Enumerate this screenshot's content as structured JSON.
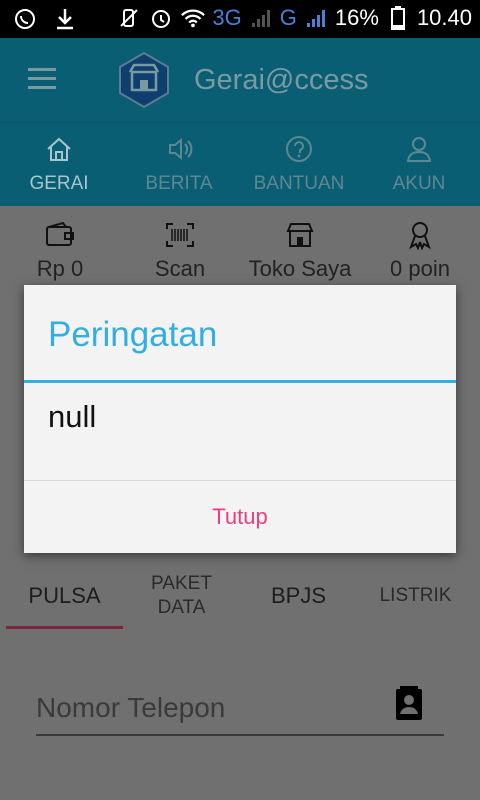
{
  "status_bar": {
    "network_3g": "3G",
    "network_g": "G",
    "battery": "16%",
    "time": "10.40"
  },
  "app_bar": {
    "title": "Gerai@ccess"
  },
  "top_tabs": [
    {
      "label": "GERAI",
      "icon": "home-icon",
      "active": true
    },
    {
      "label": "BERITA",
      "icon": "speaker-icon",
      "active": false
    },
    {
      "label": "BANTUAN",
      "icon": "help-icon",
      "active": false
    },
    {
      "label": "AKUN",
      "icon": "user-icon",
      "active": false
    }
  ],
  "wallet_row": [
    {
      "label": "Rp 0",
      "icon": "wallet-icon"
    },
    {
      "label": "Scan",
      "icon": "barcode-icon"
    },
    {
      "label": "Toko Saya",
      "icon": "store-icon"
    },
    {
      "label": "0 poin",
      "icon": "badge-icon"
    }
  ],
  "product_tabs": [
    {
      "label": "PULSA",
      "active": true
    },
    {
      "label_line1": "PAKET",
      "label_line2": "DATA",
      "active": false
    },
    {
      "label": "BPJS",
      "active": false
    },
    {
      "label": "LISTRIK",
      "active": false
    }
  ],
  "phone_input": {
    "placeholder": "Nomor Telepon"
  },
  "dialog": {
    "title": "Peringatan",
    "message": "null",
    "button": "Tutup"
  },
  "colors": {
    "accent": "#33aee0",
    "button": "#ea3f7e",
    "app_bar": "#0a5e73"
  }
}
